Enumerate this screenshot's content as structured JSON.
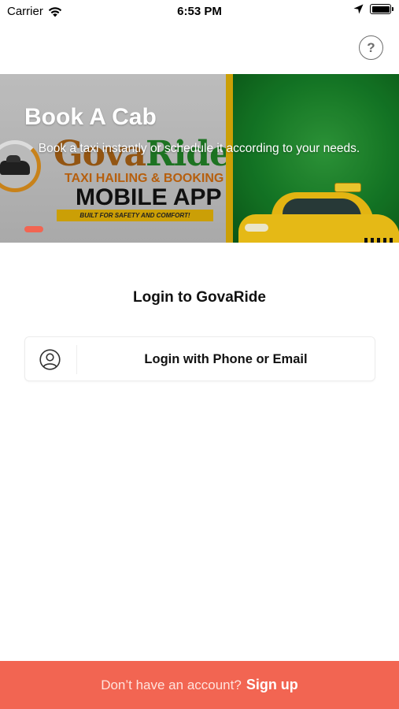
{
  "status_bar": {
    "carrier": "Carrier",
    "time": "6:53 PM"
  },
  "help": {
    "label": "?"
  },
  "banner": {
    "title": "Book A Cab",
    "subtitle": "Book a taxi instantly or schedule it according to your needs.",
    "image_text": {
      "brand_left": "Gova",
      "brand_right": "Ride",
      "sub": "TAXI HAILING & BOOKING",
      "app": "MOBILE APP",
      "tagline": "BUILT FOR SAFETY AND COMFORT!"
    },
    "pager_active_index": 0
  },
  "login": {
    "heading": "Login to GovaRide",
    "phone_email_button": "Login with Phone or Email"
  },
  "footer": {
    "prompt": "Don’t have an account?",
    "signup": "Sign up"
  },
  "colors": {
    "accent": "#f26552",
    "banner_green": "#157a26",
    "banner_gold": "#d6a807"
  },
  "icons": {
    "wifi": "wifi-icon",
    "location": "location-arrow-icon",
    "battery": "battery-icon",
    "help": "help-circle-icon",
    "user": "user-circle-icon"
  }
}
